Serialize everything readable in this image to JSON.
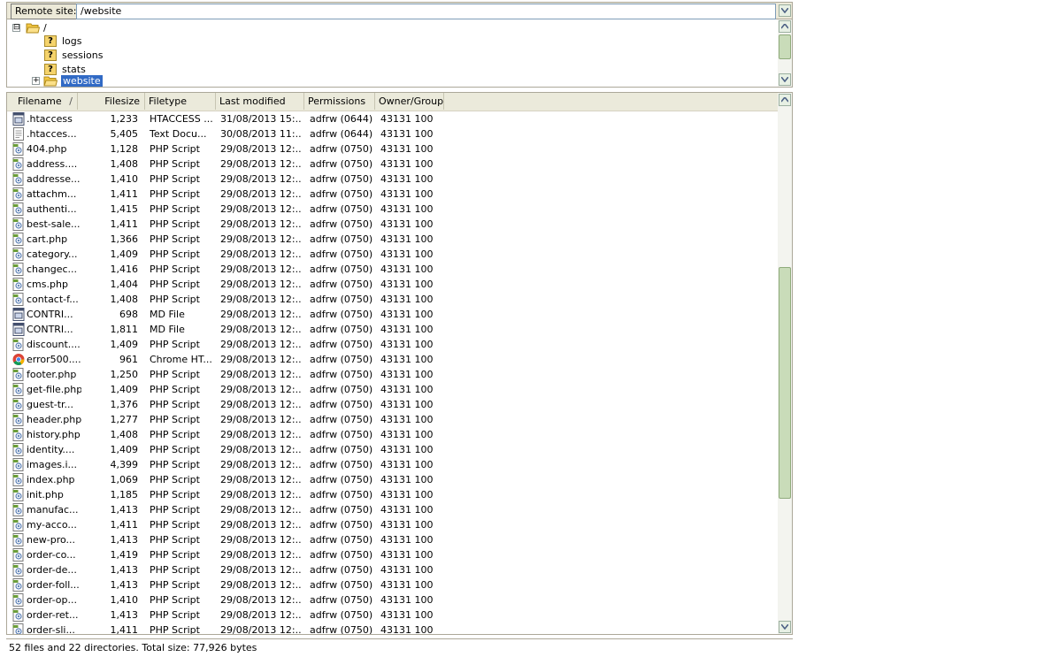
{
  "remote": {
    "label": "Remote site:",
    "path": "/website"
  },
  "tree": [
    {
      "label": "/",
      "icon": "folder-open-icon",
      "expander": "⊟"
    },
    {
      "label": "logs",
      "icon": "unknown-folder-icon"
    },
    {
      "label": "sessions",
      "icon": "unknown-folder-icon"
    },
    {
      "label": "stats",
      "icon": "unknown-folder-icon"
    },
    {
      "label": "website",
      "icon": "folder-open-icon",
      "expander": "+",
      "selected": true
    }
  ],
  "columns": {
    "filename": "Filename",
    "filesize": "Filesize",
    "filetype": "Filetype",
    "modified": "Last modified",
    "permissions": "Permissions",
    "owner": "Owner/Group"
  },
  "files": [
    {
      "name": ".htaccess",
      "size": "1,233",
      "type": "HTACCESS ...",
      "modified": "31/08/2013 15:...",
      "perm": "adfrw (0644)",
      "owner": "43131 100",
      "icon": "htaccess-file-icon"
    },
    {
      "name": ".htacces...",
      "size": "5,405",
      "type": "Text Docu...",
      "modified": "30/08/2013 11:...",
      "perm": "adfrw (0644)",
      "owner": "43131 100",
      "icon": "text-file-icon"
    },
    {
      "name": "404.php",
      "size": "1,128",
      "type": "PHP Script",
      "modified": "29/08/2013 12:...",
      "perm": "adfrw (0750)",
      "owner": "43131 100",
      "icon": "php-file-icon"
    },
    {
      "name": "address....",
      "size": "1,408",
      "type": "PHP Script",
      "modified": "29/08/2013 12:...",
      "perm": "adfrw (0750)",
      "owner": "43131 100",
      "icon": "php-file-icon"
    },
    {
      "name": "addresse...",
      "size": "1,410",
      "type": "PHP Script",
      "modified": "29/08/2013 12:...",
      "perm": "adfrw (0750)",
      "owner": "43131 100",
      "icon": "php-file-icon"
    },
    {
      "name": "attachm...",
      "size": "1,411",
      "type": "PHP Script",
      "modified": "29/08/2013 12:...",
      "perm": "adfrw (0750)",
      "owner": "43131 100",
      "icon": "php-file-icon"
    },
    {
      "name": "authenti...",
      "size": "1,415",
      "type": "PHP Script",
      "modified": "29/08/2013 12:...",
      "perm": "adfrw (0750)",
      "owner": "43131 100",
      "icon": "php-file-icon"
    },
    {
      "name": "best-sale...",
      "size": "1,411",
      "type": "PHP Script",
      "modified": "29/08/2013 12:...",
      "perm": "adfrw (0750)",
      "owner": "43131 100",
      "icon": "php-file-icon"
    },
    {
      "name": "cart.php",
      "size": "1,366",
      "type": "PHP Script",
      "modified": "29/08/2013 12:...",
      "perm": "adfrw (0750)",
      "owner": "43131 100",
      "icon": "php-file-icon"
    },
    {
      "name": "category...",
      "size": "1,409",
      "type": "PHP Script",
      "modified": "29/08/2013 12:...",
      "perm": "adfrw (0750)",
      "owner": "43131 100",
      "icon": "php-file-icon"
    },
    {
      "name": "changec...",
      "size": "1,416",
      "type": "PHP Script",
      "modified": "29/08/2013 12:...",
      "perm": "adfrw (0750)",
      "owner": "43131 100",
      "icon": "php-file-icon"
    },
    {
      "name": "cms.php",
      "size": "1,404",
      "type": "PHP Script",
      "modified": "29/08/2013 12:...",
      "perm": "adfrw (0750)",
      "owner": "43131 100",
      "icon": "php-file-icon"
    },
    {
      "name": "contact-f...",
      "size": "1,408",
      "type": "PHP Script",
      "modified": "29/08/2013 12:...",
      "perm": "adfrw (0750)",
      "owner": "43131 100",
      "icon": "php-file-icon"
    },
    {
      "name": "CONTRI...",
      "size": "698",
      "type": "MD File",
      "modified": "29/08/2013 12:...",
      "perm": "adfrw (0750)",
      "owner": "43131 100",
      "icon": "md-file-icon"
    },
    {
      "name": "CONTRI...",
      "size": "1,811",
      "type": "MD File",
      "modified": "29/08/2013 12:...",
      "perm": "adfrw (0750)",
      "owner": "43131 100",
      "icon": "md-file-icon"
    },
    {
      "name": "discount....",
      "size": "1,409",
      "type": "PHP Script",
      "modified": "29/08/2013 12:...",
      "perm": "adfrw (0750)",
      "owner": "43131 100",
      "icon": "php-file-icon"
    },
    {
      "name": "error500....",
      "size": "961",
      "type": "Chrome HT...",
      "modified": "29/08/2013 12:...",
      "perm": "adfrw (0750)",
      "owner": "43131 100",
      "icon": "chrome-html-icon"
    },
    {
      "name": "footer.php",
      "size": "1,250",
      "type": "PHP Script",
      "modified": "29/08/2013 12:...",
      "perm": "adfrw (0750)",
      "owner": "43131 100",
      "icon": "php-file-icon"
    },
    {
      "name": "get-file.php",
      "size": "1,409",
      "type": "PHP Script",
      "modified": "29/08/2013 12:...",
      "perm": "adfrw (0750)",
      "owner": "43131 100",
      "icon": "php-file-icon"
    },
    {
      "name": "guest-tr...",
      "size": "1,376",
      "type": "PHP Script",
      "modified": "29/08/2013 12:...",
      "perm": "adfrw (0750)",
      "owner": "43131 100",
      "icon": "php-file-icon"
    },
    {
      "name": "header.php",
      "size": "1,277",
      "type": "PHP Script",
      "modified": "29/08/2013 12:...",
      "perm": "adfrw (0750)",
      "owner": "43131 100",
      "icon": "php-file-icon"
    },
    {
      "name": "history.php",
      "size": "1,408",
      "type": "PHP Script",
      "modified": "29/08/2013 12:...",
      "perm": "adfrw (0750)",
      "owner": "43131 100",
      "icon": "php-file-icon"
    },
    {
      "name": "identity....",
      "size": "1,409",
      "type": "PHP Script",
      "modified": "29/08/2013 12:...",
      "perm": "adfrw (0750)",
      "owner": "43131 100",
      "icon": "php-file-icon"
    },
    {
      "name": "images.i...",
      "size": "4,399",
      "type": "PHP Script",
      "modified": "29/08/2013 12:...",
      "perm": "adfrw (0750)",
      "owner": "43131 100",
      "icon": "php-file-icon"
    },
    {
      "name": "index.php",
      "size": "1,069",
      "type": "PHP Script",
      "modified": "29/08/2013 12:...",
      "perm": "adfrw (0750)",
      "owner": "43131 100",
      "icon": "php-file-icon"
    },
    {
      "name": "init.php",
      "size": "1,185",
      "type": "PHP Script",
      "modified": "29/08/2013 12:...",
      "perm": "adfrw (0750)",
      "owner": "43131 100",
      "icon": "php-file-icon"
    },
    {
      "name": "manufac...",
      "size": "1,413",
      "type": "PHP Script",
      "modified": "29/08/2013 12:...",
      "perm": "adfrw (0750)",
      "owner": "43131 100",
      "icon": "php-file-icon"
    },
    {
      "name": "my-acco...",
      "size": "1,411",
      "type": "PHP Script",
      "modified": "29/08/2013 12:...",
      "perm": "adfrw (0750)",
      "owner": "43131 100",
      "icon": "php-file-icon"
    },
    {
      "name": "new-pro...",
      "size": "1,413",
      "type": "PHP Script",
      "modified": "29/08/2013 12:...",
      "perm": "adfrw (0750)",
      "owner": "43131 100",
      "icon": "php-file-icon"
    },
    {
      "name": "order-co...",
      "size": "1,419",
      "type": "PHP Script",
      "modified": "29/08/2013 12:...",
      "perm": "adfrw (0750)",
      "owner": "43131 100",
      "icon": "php-file-icon"
    },
    {
      "name": "order-de...",
      "size": "1,413",
      "type": "PHP Script",
      "modified": "29/08/2013 12:...",
      "perm": "adfrw (0750)",
      "owner": "43131 100",
      "icon": "php-file-icon"
    },
    {
      "name": "order-foll...",
      "size": "1,413",
      "type": "PHP Script",
      "modified": "29/08/2013 12:...",
      "perm": "adfrw (0750)",
      "owner": "43131 100",
      "icon": "php-file-icon"
    },
    {
      "name": "order-op...",
      "size": "1,410",
      "type": "PHP Script",
      "modified": "29/08/2013 12:...",
      "perm": "adfrw (0750)",
      "owner": "43131 100",
      "icon": "php-file-icon"
    },
    {
      "name": "order-ret...",
      "size": "1,413",
      "type": "PHP Script",
      "modified": "29/08/2013 12:...",
      "perm": "adfrw (0750)",
      "owner": "43131 100",
      "icon": "php-file-icon"
    },
    {
      "name": "order-sli...",
      "size": "1,411",
      "type": "PHP Script",
      "modified": "29/08/2013 12:...",
      "perm": "adfrw (0750)",
      "owner": "43131 100",
      "icon": "php-file-icon"
    }
  ],
  "status": "52 files and 22 directories. Total size: 77,926 bytes",
  "colors": {
    "selection": "#316ac5",
    "scroll_thumb": "#c9dcb9",
    "folder": "#f5c842"
  }
}
